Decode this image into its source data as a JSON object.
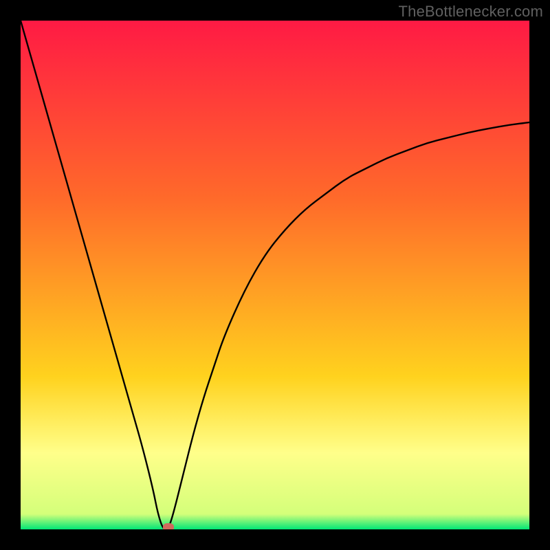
{
  "attribution": "TheBottlenecker.com",
  "colors": {
    "frame": "#000000",
    "gradient_top": "#ff1a44",
    "gradient_mid1": "#ff6a2a",
    "gradient_mid2": "#ffd21e",
    "gradient_low": "#ffff8a",
    "gradient_bottom": "#00e676",
    "curve": "#000000",
    "marker": "#cf6a5c"
  },
  "chart_data": {
    "type": "line",
    "title": "",
    "xlabel": "",
    "ylabel": "",
    "xlim": [
      0,
      100
    ],
    "ylim": [
      0,
      100
    ],
    "grid": false,
    "series": [
      {
        "name": "bottleneck-curve",
        "x": [
          0,
          2,
          4,
          6,
          8,
          10,
          12,
          14,
          16,
          18,
          20,
          22,
          24,
          26,
          27,
          28,
          29,
          30,
          32,
          34,
          36,
          38,
          40,
          44,
          48,
          52,
          56,
          60,
          64,
          68,
          72,
          76,
          80,
          84,
          88,
          92,
          96,
          100
        ],
        "values": [
          100,
          93,
          86,
          79,
          72,
          65,
          58,
          51,
          44,
          37,
          30,
          23,
          16,
          8,
          3,
          0,
          0,
          3,
          11,
          19,
          26,
          32,
          38,
          47,
          54,
          59,
          63,
          66,
          69,
          71,
          73,
          74.5,
          76,
          77,
          78,
          78.8,
          79.5,
          80
        ]
      }
    ],
    "marker": {
      "x": 29,
      "y": 0
    },
    "gradient_stops": [
      {
        "pct": 0,
        "color": "#ff1a44"
      },
      {
        "pct": 35,
        "color": "#ff6a2a"
      },
      {
        "pct": 70,
        "color": "#ffd21e"
      },
      {
        "pct": 85,
        "color": "#ffff8a"
      },
      {
        "pct": 97,
        "color": "#d4ff7a"
      },
      {
        "pct": 100,
        "color": "#00e676"
      }
    ]
  }
}
